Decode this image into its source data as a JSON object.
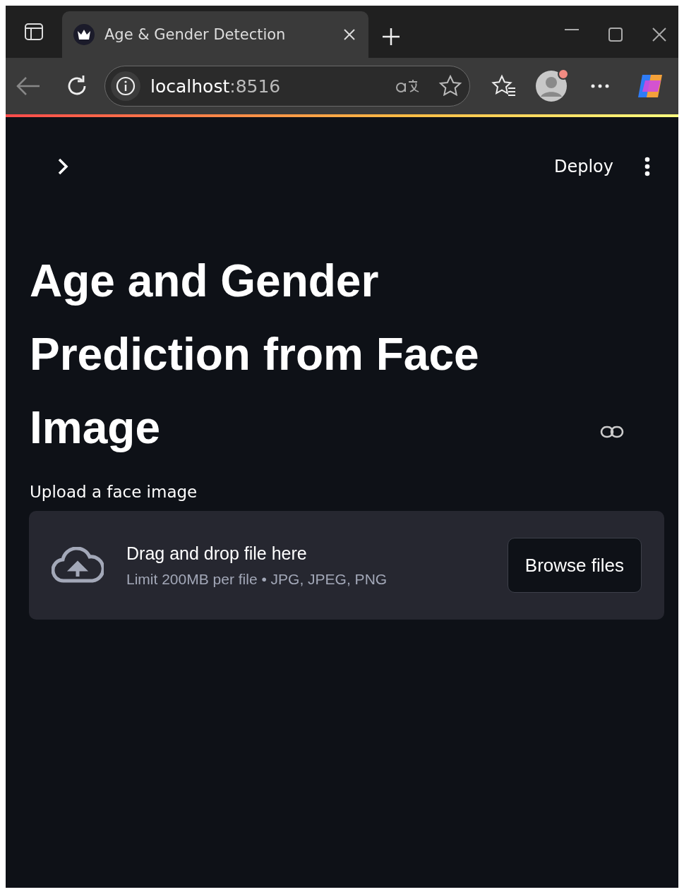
{
  "browser": {
    "tabs": [
      {
        "title": "Age & Gender Detection",
        "selected": true
      }
    ],
    "address": {
      "host": "localhost",
      "port": ":8516"
    },
    "profile_notification": true
  },
  "app": {
    "deploy_label": "Deploy",
    "title": "Age and Gender Prediction from Face Image",
    "uploader": {
      "label": "Upload a face image",
      "instruction": "Drag and drop file here",
      "limits": "Limit 200MB per file • JPG, JPEG, PNG",
      "button": "Browse files"
    }
  }
}
